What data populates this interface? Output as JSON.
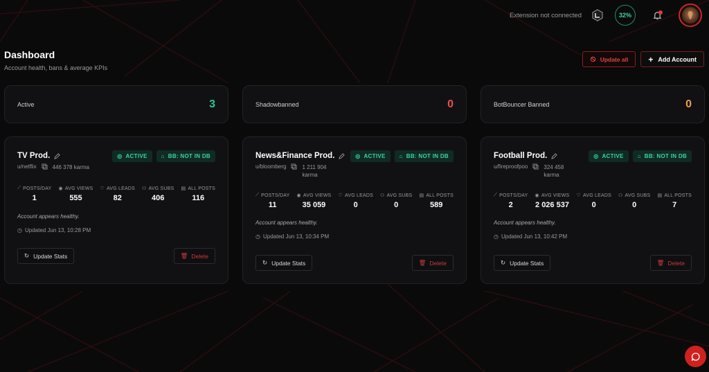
{
  "topbar": {
    "extension_status": "Extension not connected",
    "progress_percent": "32%"
  },
  "header": {
    "title": "Dashboard",
    "subtitle": "Account health, bans & average KPIs",
    "update_all_label": "Update all",
    "add_account_label": "Add Account"
  },
  "kpis": [
    {
      "label": "Active",
      "value": "3",
      "color": "#2fc48f"
    },
    {
      "label": "Shadowbanned",
      "value": "0",
      "color": "#e8504a"
    },
    {
      "label": "BotBouncer Banned",
      "value": "0",
      "color": "#e8a14a"
    }
  ],
  "stat_labels": {
    "posts_day": "POSTS/DAY",
    "avg_views": "AVG VIEWS",
    "avg_leads": "AVG LEADS",
    "avg_subs": "AVG SUBS",
    "all_posts": "ALL POSTS"
  },
  "accounts": [
    {
      "name": "TV Prod.",
      "username": "u/netflix",
      "karma": "446 378 karma",
      "status_badge": "ACTIVE",
      "bb_badge": "BB: NOT IN DB",
      "posts_day": "1",
      "avg_views": "555",
      "avg_leads": "82",
      "avg_subs": "406",
      "all_posts": "116",
      "health": "Account appears healthy.",
      "updated": "Updated Jun 13, 10:28 PM",
      "update_label": "Update Stats",
      "delete_label": "Delete"
    },
    {
      "name": "News&Finance Prod.",
      "username": "u/bloomberg",
      "karma_num": "1 211 904",
      "karma_word": "karma",
      "status_badge": "ACTIVE",
      "bb_badge": "BB: NOT IN DB",
      "posts_day": "11",
      "avg_views": "35 059",
      "avg_leads": "0",
      "avg_subs": "0",
      "all_posts": "589",
      "health": "Account appears healthy.",
      "updated": "Updated Jun 13, 10:34 PM",
      "update_label": "Update Stats",
      "delete_label": "Delete"
    },
    {
      "name": "Football Prod.",
      "username": "u/fireproofpoo",
      "karma_num": "324 458",
      "karma_word": "karma",
      "status_badge": "ACTIVE",
      "bb_badge": "BB: NOT IN DB",
      "posts_day": "2",
      "avg_views": "2 026 537",
      "avg_leads": "0",
      "avg_subs": "0",
      "all_posts": "7",
      "health": "Account appears healthy.",
      "updated": "Updated Jun 13, 10:42 PM",
      "update_label": "Update Stats",
      "delete_label": "Delete"
    }
  ]
}
